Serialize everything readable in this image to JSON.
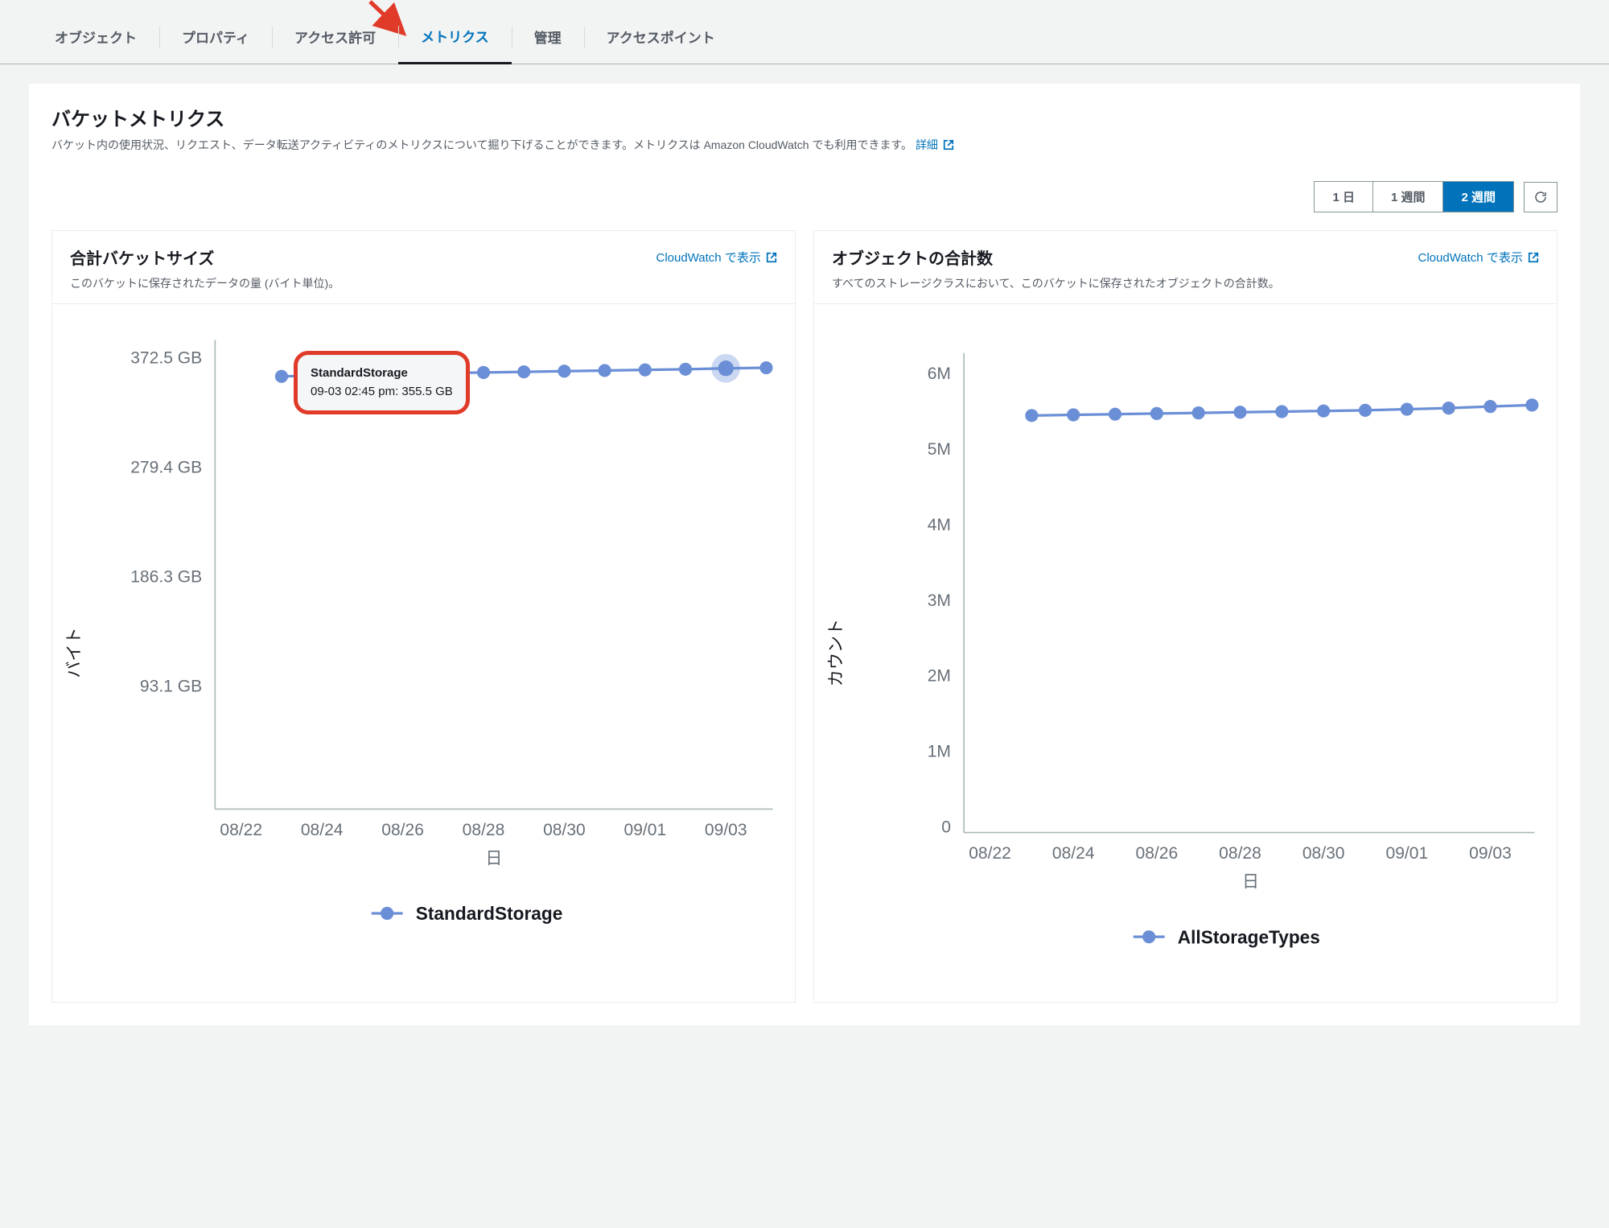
{
  "tabs": {
    "objects": "オブジェクト",
    "properties": "プロパティ",
    "permissions": "アクセス許可",
    "metrics": "メトリクス",
    "management": "管理",
    "access_points": "アクセスポイント"
  },
  "header": {
    "title": "バケットメトリクス",
    "desc_prefix": "バケット内の使用状況、リクエスト、データ転送アクティビティのメトリクスについて掘り下げることができます。メトリクスは Amazon CloudWatch でも利用できます。",
    "learn_more": "詳細"
  },
  "range": {
    "one_day": "1 日",
    "one_week": "1 週間",
    "two_weeks": "2 週間"
  },
  "cloudwatch_link": "CloudWatch で表示",
  "cards": {
    "size": {
      "title": "合計バケットサイズ",
      "sub": "このバケットに保存されたデータの量 (バイト単位)。",
      "ylabel": "バイト",
      "xlabel": "日",
      "legend": "StandardStorage"
    },
    "count": {
      "title": "オブジェクトの合計数",
      "sub": "すべてのストレージクラスにおいて、このバケットに保存されたオブジェクトの合計数。",
      "ylabel": "カウント",
      "xlabel": "日",
      "legend": "AllStorageTypes"
    }
  },
  "tooltip": {
    "series": "StandardStorage",
    "line": "09-03 02:45 pm: 355.5 GB"
  },
  "chart_data": [
    {
      "type": "line",
      "title": "合計バケットサイズ",
      "xlabel": "日",
      "ylabel": "バイト",
      "series_name": "StandardStorage",
      "x_ticks": [
        "08/22",
        "08/24",
        "08/26",
        "08/28",
        "08/30",
        "09/01",
        "09/03"
      ],
      "y_ticks_labels": [
        "93.1 GB",
        "186.3 GB",
        "279.4 GB",
        "372.5 GB"
      ],
      "y_ticks_values": [
        93.1,
        186.3,
        279.4,
        372.5
      ],
      "ylim": [
        0,
        400
      ],
      "x": [
        "08/23",
        "08/24",
        "08/25",
        "08/26",
        "08/27",
        "08/28",
        "08/29",
        "08/30",
        "08/31",
        "09/01",
        "09/02",
        "09/03",
        "09/04"
      ],
      "values_gb": [
        347,
        348,
        349,
        350,
        350.5,
        351,
        351.5,
        352,
        353,
        353.5,
        354.5,
        355.5,
        356
      ],
      "highlight": {
        "x": "09/03",
        "value_gb": 355.5,
        "timestamp": "09-03 02:45 pm"
      }
    },
    {
      "type": "line",
      "title": "オブジェクトの合計数",
      "xlabel": "日",
      "ylabel": "カウント",
      "series_name": "AllStorageTypes",
      "x_ticks": [
        "08/22",
        "08/24",
        "08/26",
        "08/28",
        "08/30",
        "09/01",
        "09/03"
      ],
      "y_ticks_labels": [
        "0",
        "1M",
        "2M",
        "3M",
        "4M",
        "5M",
        "6M"
      ],
      "y_ticks_values": [
        0,
        1000000,
        2000000,
        3000000,
        4000000,
        5000000,
        6000000
      ],
      "ylim": [
        0,
        6500000
      ],
      "x": [
        "08/23",
        "08/24",
        "08/25",
        "08/26",
        "08/27",
        "08/28",
        "08/29",
        "08/30",
        "08/31",
        "09/01",
        "09/02",
        "09/03",
        "09/04"
      ],
      "values": [
        5450000,
        5460000,
        5470000,
        5480000,
        5490000,
        5500000,
        5510000,
        5520000,
        5530000,
        5545000,
        5560000,
        5580000,
        5600000
      ]
    }
  ]
}
